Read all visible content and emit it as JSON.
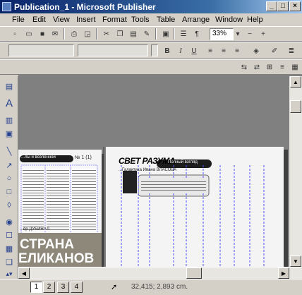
{
  "window": {
    "title": "Publication_1 - Microsoft Publisher"
  },
  "menu": [
    "File",
    "Edit",
    "View",
    "Insert",
    "Format",
    "Tools",
    "Table",
    "Arrange",
    "Window",
    "Help"
  ],
  "toolbar": {
    "zoom": "33%"
  },
  "document": {
    "left_page": {
      "banner": "...лы и вселенной",
      "column_head": "№ 1 (1)",
      "footer": "...вр  ДУБИНАЛ",
      "big_text_1": "СТРАНА",
      "big_text_2": "ЕЛИКАНОВ"
    },
    "right_page": {
      "logo": "СВЕТ РАЗУМА",
      "pill": "Полный взгляд",
      "subhead": "...Галактика Ивана ВЛАСОВА"
    }
  },
  "status": {
    "pages": [
      "1",
      "2",
      "3",
      "4"
    ],
    "position": "32,415; 2,893 cm."
  },
  "colors": {
    "title_start": "#0a246a",
    "title_end": "#a6caf0",
    "guide": "#5050ff",
    "workspace": "#808080"
  }
}
